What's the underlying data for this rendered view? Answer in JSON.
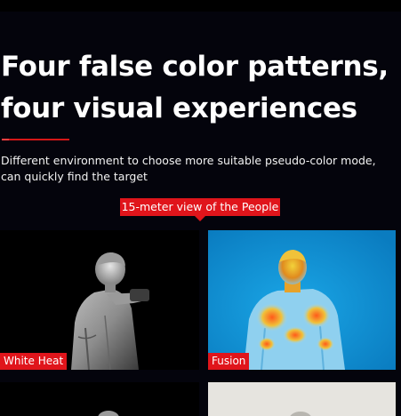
{
  "headline": {
    "line1": "Four false color patterns,",
    "line2": "four visual experiences"
  },
  "description": {
    "line1": "Different environment to choose more suitable pseudo-color mode,",
    "line2": "can quickly find the target"
  },
  "view_badge": "15-meter view of the  People",
  "modes": [
    {
      "label": "White Heat"
    },
    {
      "label": "Fusion"
    }
  ],
  "colors": {
    "accent": "#e0151b",
    "background": "#04040c",
    "fusion_background": "#0e8fd2"
  }
}
